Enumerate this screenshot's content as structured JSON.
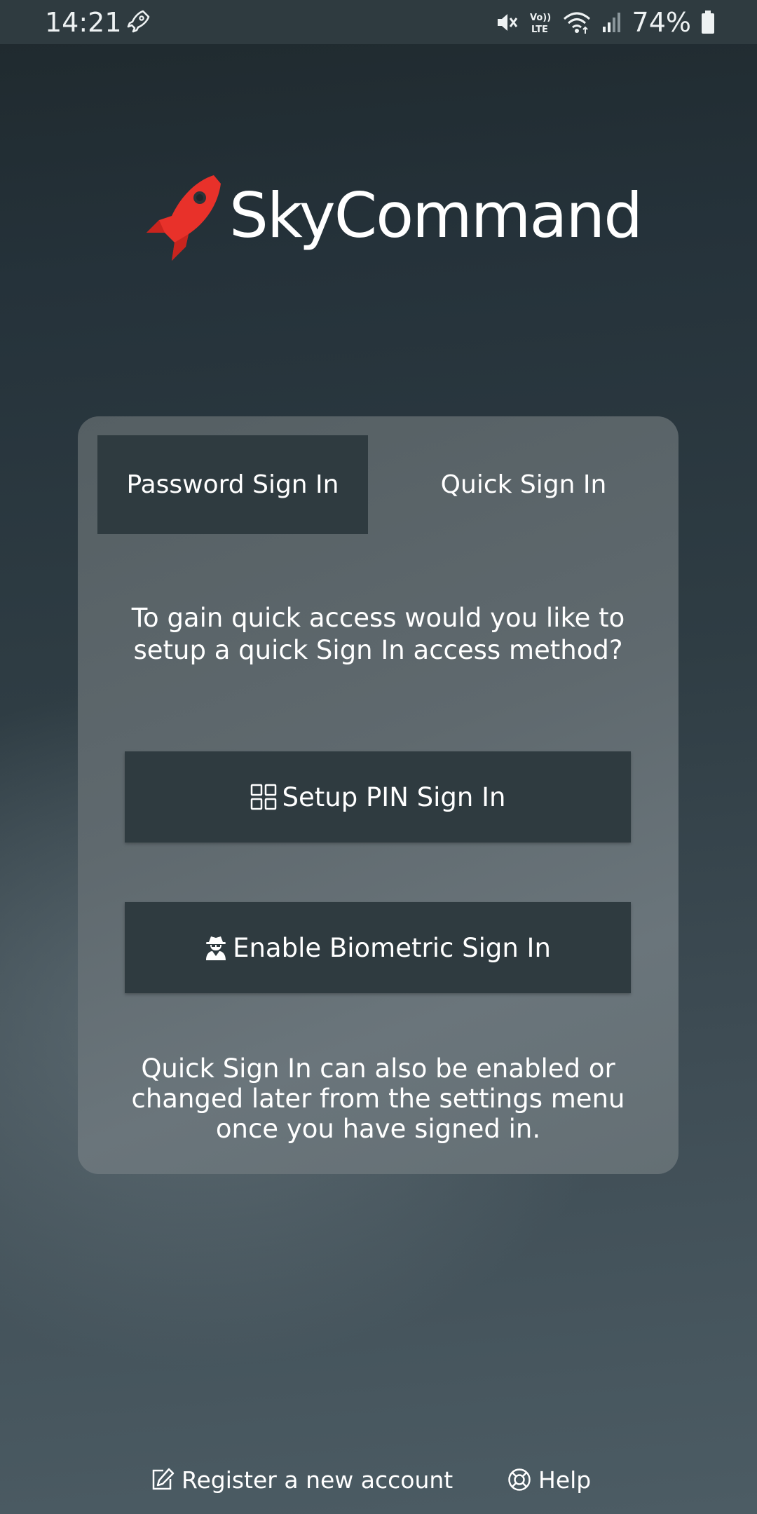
{
  "status_bar": {
    "time": "14:21",
    "battery_percent": "74%",
    "icons": [
      "rocket-notification-icon",
      "mute-icon",
      "volte-icon",
      "wifi-icon",
      "signal-icon",
      "battery-icon"
    ]
  },
  "logo": {
    "text": "SkyCommand",
    "icon": "rocket-logo-icon",
    "accent_color": "#e8312a"
  },
  "tabs": [
    {
      "label": "Password Sign In",
      "selected": true
    },
    {
      "label": "Quick Sign In",
      "selected": false
    }
  ],
  "card": {
    "intro_text": "To gain quick access would you like to setup a quick Sign In access method?",
    "pin_button_label": "Setup PIN Sign In",
    "pin_button_icon": "grid-icon",
    "biometric_button_label": "Enable Biometric Sign In",
    "biometric_button_icon": "spy-icon",
    "note_text": "Quick Sign In can also be enabled or changed later from the settings menu once you have signed in."
  },
  "footer": {
    "register_label": "Register a new account",
    "register_icon": "edit-icon",
    "help_label": "Help",
    "help_icon": "lifebuoy-icon"
  },
  "colors": {
    "button_background": "#2f3b40",
    "card_background": "#5f696e",
    "text": "#ffffff"
  }
}
